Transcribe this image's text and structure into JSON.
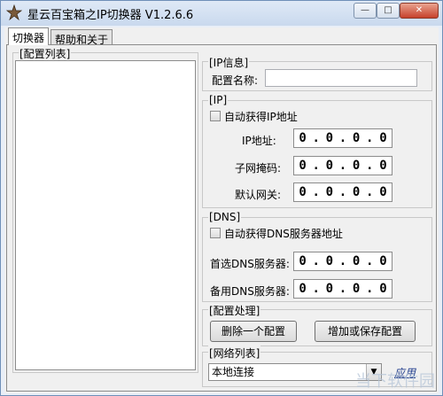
{
  "window": {
    "title": "星云百宝箱之IP切换器 V1.2.6.6",
    "min_glyph": "—",
    "max_glyph": "□",
    "close_glyph": "✕"
  },
  "tabs": [
    {
      "label": "切换器"
    },
    {
      "label": "帮助和关于"
    }
  ],
  "config_list": {
    "legend": "[配置列表]"
  },
  "ip_info": {
    "legend": "[IP信息]",
    "name_label": "配置名称:",
    "name_value": ""
  },
  "ip": {
    "legend": "[IP]",
    "auto_label": "自动获得IP地址",
    "address_label": "IP地址:",
    "mask_label": "子网掩码:",
    "gateway_label": "默认网关:",
    "address": [
      "0",
      "0",
      "0",
      "0"
    ],
    "mask": [
      "0",
      "0",
      "0",
      "0"
    ],
    "gateway": [
      "0",
      "0",
      "0",
      "0"
    ]
  },
  "dns": {
    "legend": "[DNS]",
    "auto_label": "自动获得DNS服务器地址",
    "primary_label": "首选DNS服务器:",
    "secondary_label": "备用DNS服务器:",
    "primary": [
      "0",
      "0",
      "0",
      "0"
    ],
    "secondary": [
      "0",
      "0",
      "0",
      "0"
    ]
  },
  "config_actions": {
    "legend": "[配置处理]",
    "delete_label": "删除一个配置",
    "save_label": "增加或保存配置"
  },
  "network_list": {
    "legend": "[网络列表]",
    "selected": "本地连接",
    "apply_label": "应用"
  },
  "watermark": {
    "text": "当下软件园"
  }
}
